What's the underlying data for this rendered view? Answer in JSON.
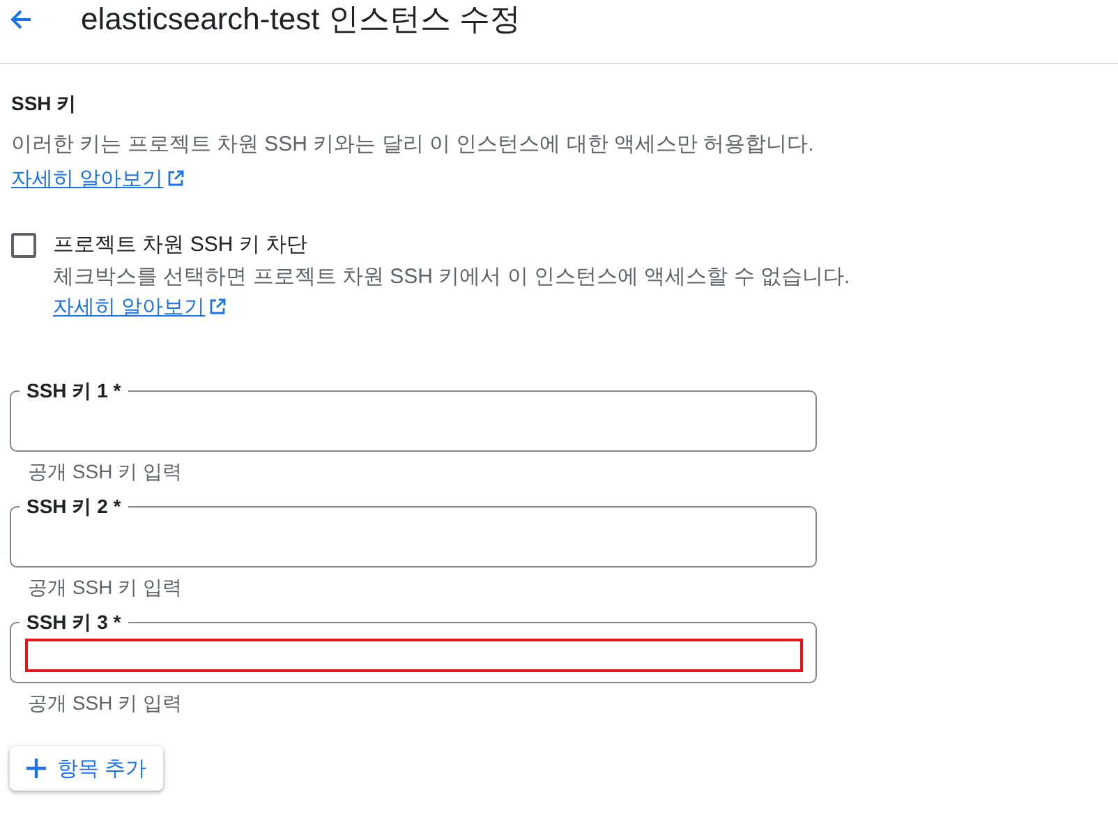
{
  "header": {
    "title": "elasticsearch-test 인스턴스 수정"
  },
  "ssh_section": {
    "title": "SSH 키",
    "description": "이러한 키는 프로젝트 차원 SSH 키와는 달리 이 인스턴스에 대한 액세스만 허용합니다.",
    "link": "자세히 알아보기"
  },
  "block_project_keys": {
    "label": "프로젝트 차원 SSH 키 차단",
    "checked": false,
    "description": "체크박스를 선택하면 프로젝트 차원 SSH 키에서 이 인스턴스에 액세스할 수 없습니다.",
    "link": "자세히 알아보기"
  },
  "ssh_keys": [
    {
      "label": "SSH 키 1 *",
      "helper": "공개 SSH 키 입력",
      "highlighted": false
    },
    {
      "label": "SSH 키 2 *",
      "helper": "공개 SSH 키 입력",
      "highlighted": false
    },
    {
      "label": "SSH 키 3 *",
      "helper": "공개 SSH 키 입력",
      "highlighted": true
    }
  ],
  "add_button": {
    "label": "항목 추가"
  }
}
